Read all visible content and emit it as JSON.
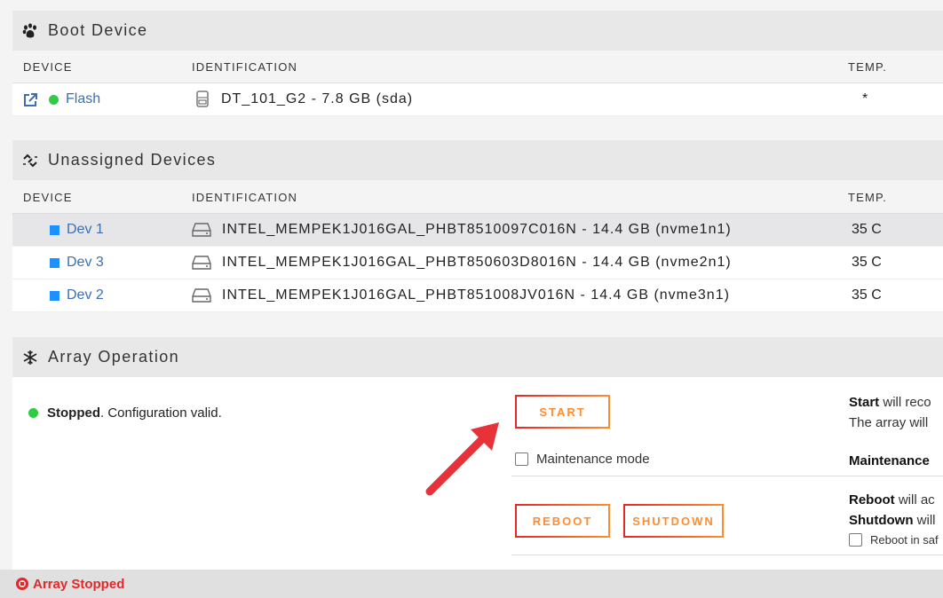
{
  "boot": {
    "title": "Boot Device",
    "icon": "paw-icon",
    "headers": {
      "device": "DEVICE",
      "identification": "IDENTIFICATION",
      "temp": "TEMP."
    },
    "rows": [
      {
        "device": "Flash",
        "identification": "DT_101_G2 - 7.8 GB (sda)",
        "temp": "*",
        "status_color": "#2ecc40"
      }
    ]
  },
  "unassigned": {
    "title": "Unassigned Devices",
    "icon": "unlink-icon",
    "headers": {
      "device": "DEVICE",
      "identification": "IDENTIFICATION",
      "temp": "TEMP."
    },
    "rows": [
      {
        "device": "Dev 1",
        "identification": "INTEL_MEMPEK1J016GAL_PHBT8510097C016N - 14.4 GB (nvme1n1)",
        "temp": "35 C"
      },
      {
        "device": "Dev 3",
        "identification": "INTEL_MEMPEK1J016GAL_PHBT850603D8016N - 14.4 GB (nvme2n1)",
        "temp": "35 C"
      },
      {
        "device": "Dev 2",
        "identification": "INTEL_MEMPEK1J016GAL_PHBT851008JV016N - 14.4 GB (nvme3n1)",
        "temp": "35 C"
      }
    ]
  },
  "array": {
    "title": "Array Operation",
    "icon": "snowflake-icon",
    "status_bold": "Stopped",
    "status_rest": ". Configuration valid.",
    "start_label": "START",
    "maintenance_label": "Maintenance mode",
    "reboot_label": "REBOOT",
    "shutdown_label": "SHUTDOWN",
    "desc_start_bold": "Start",
    "desc_start_rest": " will reco",
    "desc_start_line2": "The array will",
    "desc_maintenance_bold": "Maintenance",
    "desc_reboot_bold": "Reboot",
    "desc_reboot_rest": " will ac",
    "desc_shutdown_bold": "Shutdown",
    "desc_shutdown_rest": " will",
    "safe_label": "Reboot in saf"
  },
  "footer": {
    "status": "Array Stopped"
  },
  "colors": {
    "accent_orange": "#ff8c2f",
    "accent_red": "#e22828",
    "link_blue": "#3c6eb4",
    "status_green": "#2ecc40",
    "device_blue": "#1e90ff"
  }
}
